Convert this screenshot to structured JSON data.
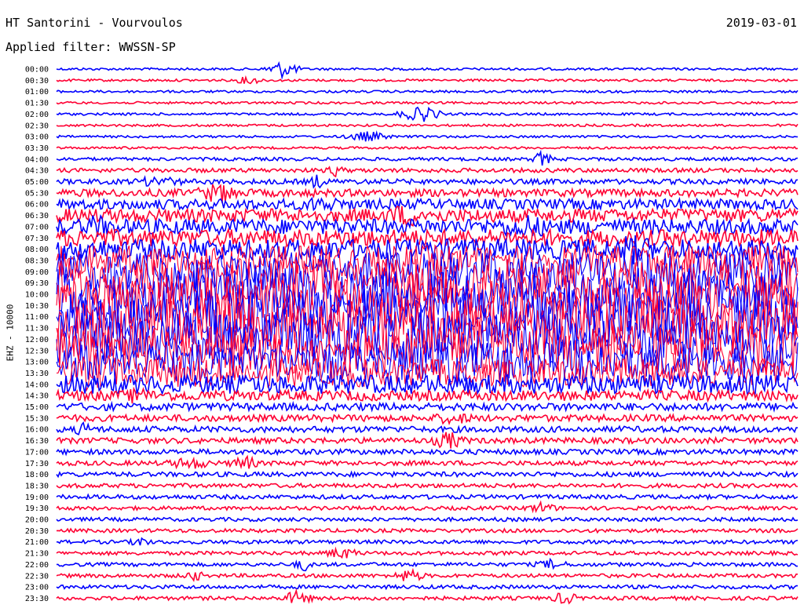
{
  "header": {
    "title": "HT Santorini - Vourvoulos",
    "date": "2019-03-01",
    "filter": "Applied filter: WWSSN-SP"
  },
  "channel_label": "EHZ - 10000",
  "colors": {
    "trace_a": "#0000ff",
    "trace_b": "#ff0033",
    "background": "#ffffff"
  },
  "chart_data": {
    "type": "line",
    "subtype": "helicorder",
    "y_tick_labels": [
      "00:00",
      "00:30",
      "01:00",
      "01:30",
      "02:00",
      "02:30",
      "03:00",
      "03:30",
      "04:00",
      "04:30",
      "05:00",
      "05:30",
      "06:00",
      "06:30",
      "07:00",
      "07:30",
      "08:00",
      "08:30",
      "09:00",
      "09:30",
      "10:00",
      "10:30",
      "11:00",
      "11:30",
      "12:00",
      "12:30",
      "13:00",
      "13:30",
      "14:00",
      "14:30",
      "15:00",
      "15:30",
      "16:00",
      "16:30",
      "17:00",
      "17:30",
      "18:00",
      "18:30",
      "19:00",
      "19:30",
      "20:00",
      "20:30",
      "21:00",
      "21:30",
      "22:00",
      "22:30",
      "23:00",
      "23:30"
    ],
    "trace_colors_alternating": [
      "#0000ff",
      "#ff0033"
    ],
    "relative_noise_level": [
      0.05,
      0.05,
      0.05,
      0.05,
      0.05,
      0.05,
      0.05,
      0.05,
      0.15,
      0.25,
      0.35,
      0.6,
      0.9,
      1.2,
      1.4,
      1.6,
      2.0,
      3.0,
      4.0,
      5.0,
      5.5,
      6.0,
      6.0,
      6.0,
      5.5,
      5.0,
      4.0,
      2.8,
      1.8,
      0.9,
      0.6,
      0.5,
      0.45,
      0.4,
      0.35,
      0.3,
      0.3,
      0.25,
      0.25,
      0.2,
      0.2,
      0.2,
      0.2,
      0.2,
      0.2,
      0.2,
      0.2,
      0.2
    ],
    "grid": false
  }
}
